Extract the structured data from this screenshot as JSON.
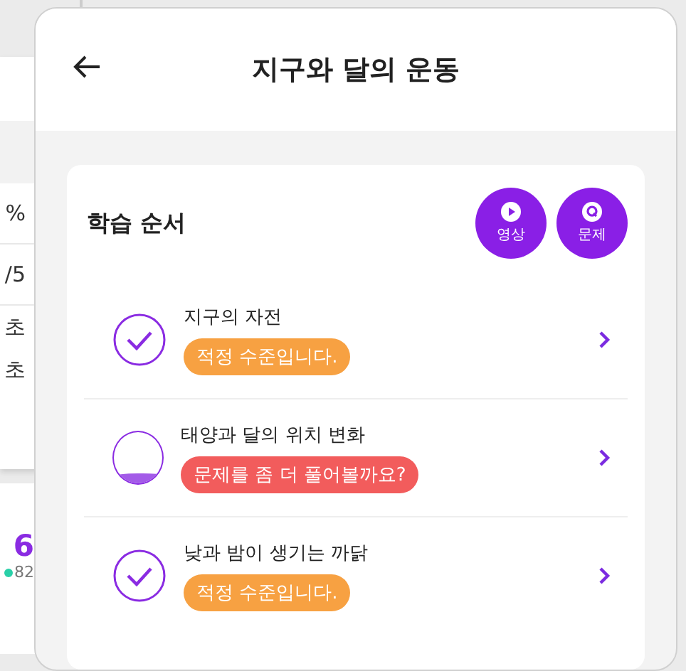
{
  "background_page": {
    "values": [
      "%",
      "/5",
      "초",
      "초"
    ],
    "score": "6",
    "points": "82"
  },
  "modal": {
    "title": "지구와 달의 운동",
    "card": {
      "title": "학습 순서",
      "actions": [
        {
          "kind": "video",
          "label": "영상"
        },
        {
          "kind": "quiz",
          "label": "문제"
        }
      ],
      "items": [
        {
          "title": "지구의 자전",
          "kind": "check",
          "badge": "적정 수준입니다.",
          "color": "#f7a142"
        },
        {
          "title": "태양과 달의 위치 변화",
          "kind": "progress",
          "level": 0.2,
          "badge": "문제를 좀 더 풀어볼까요?",
          "color": "#f25c5c"
        },
        {
          "title": "낮과 밤이 생기는 까닭",
          "kind": "check",
          "badge": "적정 수준입니다.",
          "color": "#f7a142"
        }
      ]
    }
  }
}
